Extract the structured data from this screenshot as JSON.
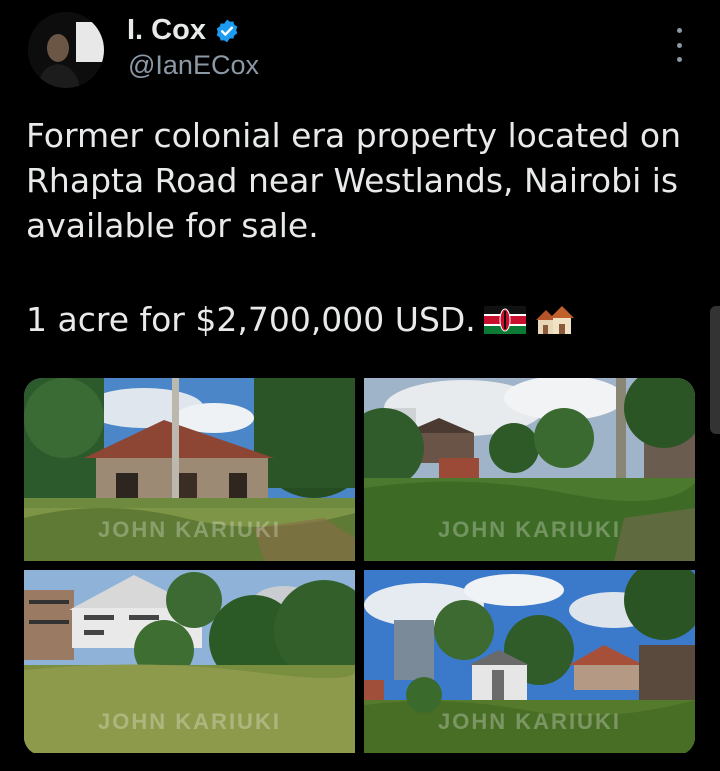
{
  "author": {
    "display_name": "I. Cox",
    "handle": "@IanECox"
  },
  "tweet": {
    "text": "Former colonial era property located on\nRhapta Road near Westlands, Nairobi is\navailable for sale.",
    "price_line": "1 acre for $2,700,000 USD."
  },
  "icons": {
    "verified": "verified-badge-icon",
    "more": "more-options-icon",
    "flag": "kenya-flag-emoji",
    "houses": "houses-emoji"
  },
  "photos": [
    {
      "alt": "house-photo-1",
      "watermark": "JOHN KARIUKI"
    },
    {
      "alt": "house-photo-2",
      "watermark": "JOHN KARIUKI"
    },
    {
      "alt": "house-photo-3",
      "watermark": "JOHN KARIUKI"
    },
    {
      "alt": "house-photo-4",
      "watermark": "JOHN KARIUKI"
    }
  ],
  "colors": {
    "background": "#000000",
    "text": "#e7e9ea",
    "secondary_text": "#8b98a5",
    "verified_blue": "#1d9bf0"
  }
}
